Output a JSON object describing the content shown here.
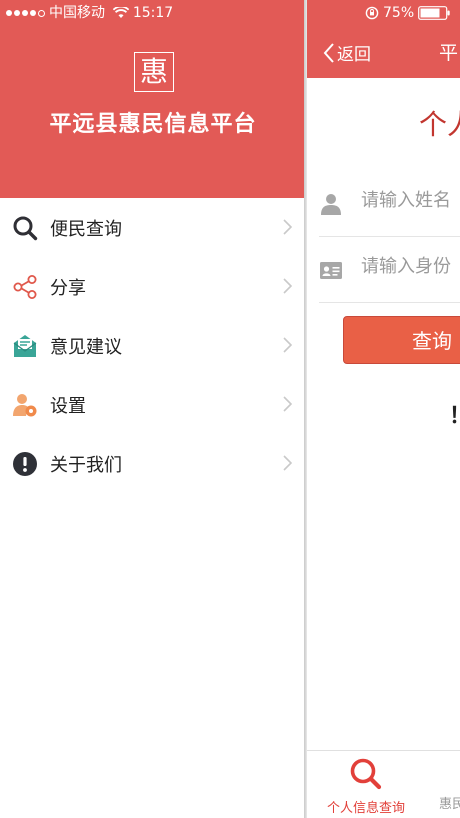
{
  "status_bar": {
    "carrier": "中国移动",
    "time": "15:17",
    "battery_percent": "75%"
  },
  "drawer": {
    "logo_char": "惠",
    "app_name": "平远县惠民信息平台",
    "menu": [
      {
        "label": "便民查询",
        "icon": "search-icon"
      },
      {
        "label": "分享",
        "icon": "share-icon"
      },
      {
        "label": "意见建议",
        "icon": "feedback-envelope-icon"
      },
      {
        "label": "设置",
        "icon": "user-settings-icon"
      },
      {
        "label": "关于我们",
        "icon": "info-icon"
      }
    ]
  },
  "panel": {
    "back_label": "返回",
    "nav_title": "平",
    "title": "个人",
    "name_placeholder": "请输入姓名",
    "id_placeholder": "请输入身份",
    "query_label": "查询",
    "stray_char": "！",
    "tabs": [
      {
        "label": "个人信息查询",
        "icon": "search-icon",
        "active": true
      },
      {
        "label": "惠民",
        "icon": "",
        "active": false
      }
    ]
  },
  "colors": {
    "brand_red": "#e25a56",
    "button_red": "#e96046",
    "title_red": "#c2362f",
    "tab_active": "#e2403a"
  }
}
